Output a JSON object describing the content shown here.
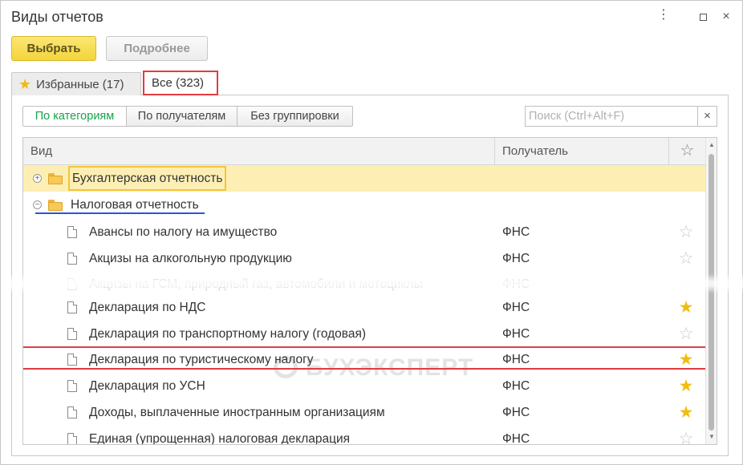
{
  "window": {
    "title": "Виды отчетов",
    "more_glyph": "⋮",
    "close_glyph": "×"
  },
  "toolbar": {
    "select_label": "Выбрать",
    "more_label": "Подробнее"
  },
  "tabs": [
    {
      "label": "Избранные (17)",
      "icon": "star-icon",
      "active": false
    },
    {
      "label": "Все (323)",
      "active": true
    }
  ],
  "grouping": {
    "options": [
      "По категориям",
      "По получателям",
      "Без группировки"
    ],
    "selected": "По категориям"
  },
  "search": {
    "placeholder": "Поиск (Ctrl+Alt+F)",
    "value": "",
    "clear_glyph": "×"
  },
  "table": {
    "columns": {
      "kind": "Вид",
      "recipient": "Получатель",
      "favorite_glyph": "☆"
    },
    "groups": [
      {
        "name": "Бухгалтерская отчетность",
        "expanded": false,
        "toggle": "+"
      },
      {
        "name": "Налоговая отчетность",
        "expanded": true,
        "toggle": "−"
      }
    ],
    "rows": [
      {
        "name": "Авансы по налогу на имущество",
        "recipient": "ФНС",
        "favorite": false
      },
      {
        "name": "Акцизы на алкогольную продукцию",
        "recipient": "ФНС",
        "favorite": false
      },
      {
        "name": "Акцизы на ГСМ, природный газ, автомобили и мотоциклы",
        "recipient": "ФНС",
        "favorite": false
      },
      {
        "name": "Декларация по НДС",
        "recipient": "ФНС",
        "favorite": true
      },
      {
        "name": "Декларация по транспортному налогу (годовая)",
        "recipient": "ФНС",
        "favorite": false
      },
      {
        "name": "Декларация по туристическому налогу",
        "recipient": "ФНС",
        "favorite": true
      },
      {
        "name": "Декларация по УСН",
        "recipient": "ФНС",
        "favorite": true
      },
      {
        "name": "Доходы, выплаченные иностранным организациям",
        "recipient": "ФНС",
        "favorite": true
      },
      {
        "name": "Единая (упрощенная) налоговая декларация",
        "recipient": "ФНС",
        "favorite": false
      }
    ]
  },
  "watermark": {
    "text": "БУХЭКСПЕРТ"
  },
  "scrollbar": {
    "up_glyph": "▲",
    "down_glyph": "▼"
  },
  "colors": {
    "accent_yellow": "#f4d43a",
    "group_highlight": "#fdefb4",
    "selection_red": "#e03c41",
    "underline_blue": "#2b55d8",
    "star_on": "#f0bd11",
    "active_segment_green": "#16a34a"
  }
}
